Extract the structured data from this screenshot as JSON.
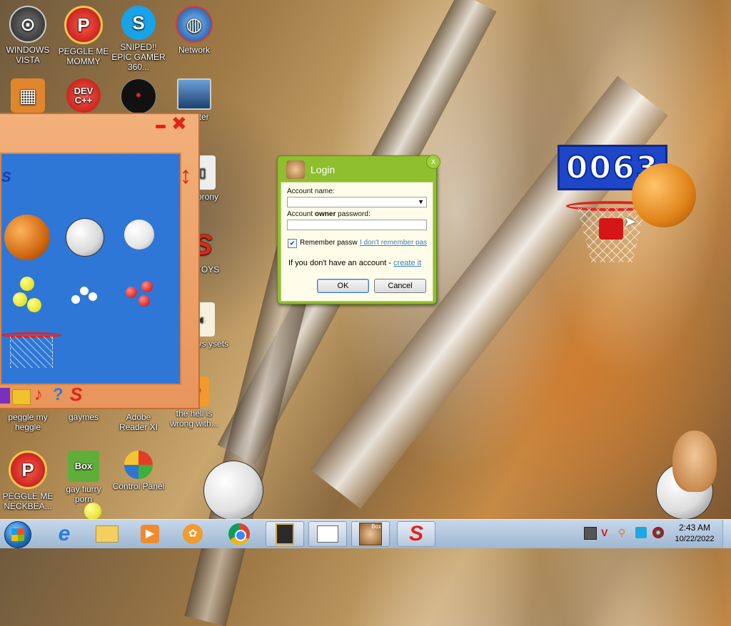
{
  "desktop_icons": [
    {
      "label": "WINDOWS VISTA",
      "icon": "windows-vista-icon"
    },
    {
      "label": "PEGGLE ME MOMMY",
      "icon": "peggle-icon"
    },
    {
      "label": "SNIPED!! EPIC GAMER 360...",
      "icon": "skype-icon"
    },
    {
      "label": "Network",
      "icon": "network-icon"
    },
    {
      "label": "DEV C++",
      "icon": "dev-cpp-icon"
    },
    {
      "label": "puter",
      "icon": "computer-icon"
    },
    {
      "label": "prony",
      "icon": "generic-icon"
    },
    {
      "label": "TOYS",
      "icon": "toys-icon"
    },
    {
      "label": "otoys ysets",
      "icon": "toysets-icon"
    },
    {
      "label": "peggle my heggle",
      "icon": "peggle-icon"
    },
    {
      "label": "gaymes",
      "icon": "folder-icon"
    },
    {
      "label": "Adobe Reader XI",
      "icon": "adobe-reader-icon"
    },
    {
      "label": "the hell is wrong with...",
      "icon": "generic-icon"
    },
    {
      "label": "PEGGLE ME NECKBEA...",
      "icon": "peggle-icon"
    },
    {
      "label": "gay fiurry porn",
      "icon": "box-icon"
    },
    {
      "label": "Control Panel",
      "icon": "control-panel-icon"
    }
  ],
  "scoreboard": {
    "value": "0063"
  },
  "login": {
    "title": "Login",
    "close": "x",
    "account_label": "Account name:",
    "password_label_pre": "Account ",
    "password_label_bold": "owner",
    "password_label_post": " password:",
    "account_value": "",
    "password_value": "",
    "remember_label": "Remember passw",
    "remember_checked": true,
    "forgot_link": "I don't remember pas",
    "no_account_text": "If you don't have an account - ",
    "create_link": "create it",
    "ok_label": "OK",
    "cancel_label": "Cancel"
  },
  "taskbar": {
    "clock_time": "2:43 AM",
    "clock_date": "10/22/2022",
    "items": [
      "start-orb",
      "internet-explorer-icon",
      "file-explorer-icon",
      "media-player-icon",
      "ubar-icon",
      "chrome-icon",
      "toybox-window-icon",
      "control-window-icon",
      "box-app-icon",
      "toys-app-icon"
    ]
  },
  "colors": {
    "accent": "#8fbe2e",
    "scoreboard_bg": "#1d46c9",
    "toybox_bg": "#2e77d6",
    "taskbar": "#b3c8e0"
  }
}
